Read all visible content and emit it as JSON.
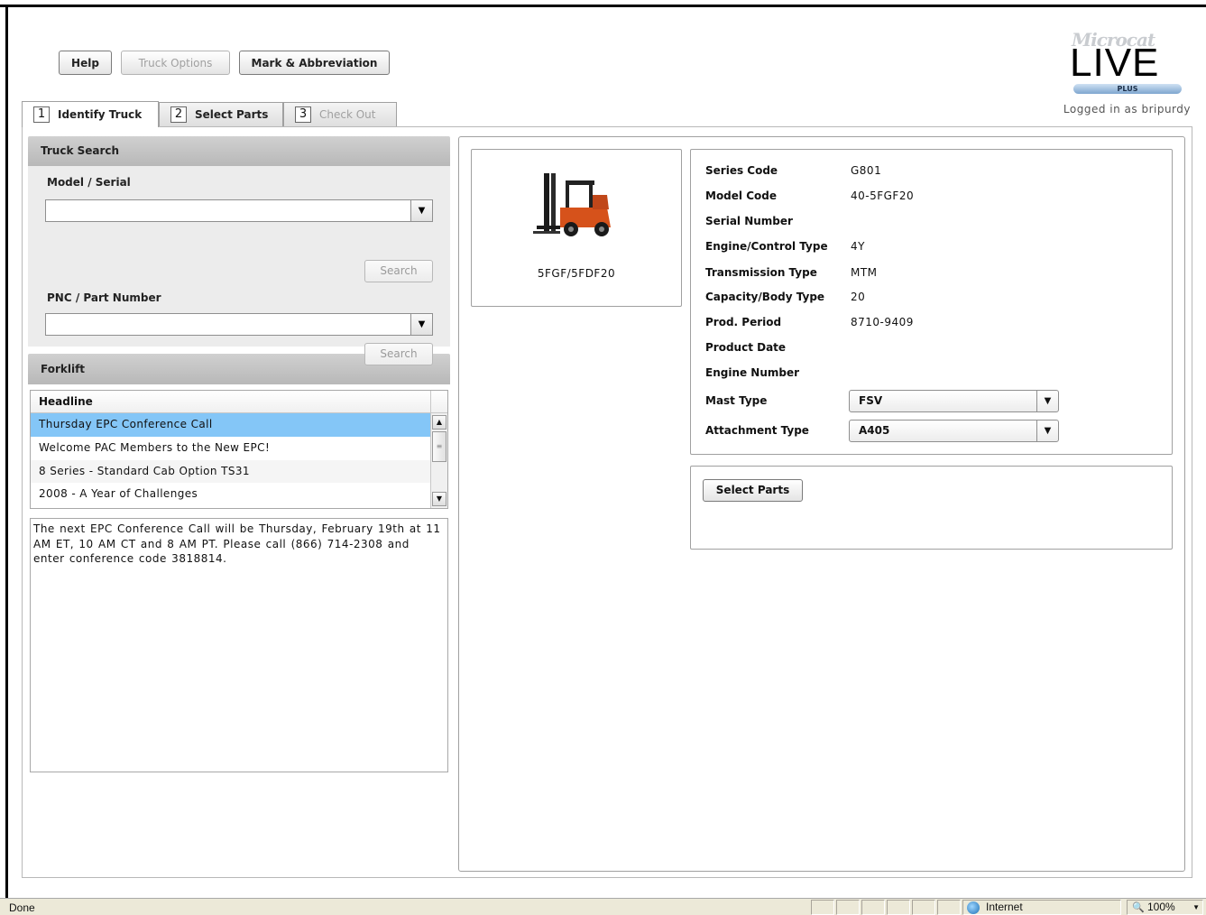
{
  "toolbar": {
    "help_label": "Help",
    "truck_options_label": "Truck Options",
    "mark_abbrev_label": "Mark & Abbreviation"
  },
  "logo": {
    "micro": "Microcat",
    "live": "LIVE",
    "plus": "PLUS"
  },
  "user": {
    "logged_in_text": "Logged in as bripurdy"
  },
  "tabs": [
    {
      "num": "1",
      "label": "Identify Truck",
      "state": "active"
    },
    {
      "num": "2",
      "label": "Select Parts",
      "state": "enabled"
    },
    {
      "num": "3",
      "label": "Check Out",
      "state": "disabled"
    }
  ],
  "truck_search": {
    "title": "Truck Search",
    "model_serial_label": "Model / Serial",
    "model_serial_value": "",
    "search1_label": "Search",
    "pnc_label": "PNC / Part Number",
    "pnc_value": "",
    "search2_label": "Search"
  },
  "forklift": {
    "title": "Forklift",
    "column_header": "Headline",
    "items": [
      "Thursday EPC Conference Call",
      "Welcome PAC Members to the New EPC!",
      "8 Series - Standard Cab Option TS31",
      "2008 - A Year of Challenges"
    ],
    "selected_index": 0,
    "detail_text": "The next EPC Conference Call will be Thursday, February 19th at 11 AM ET, 10 AM CT and 8 AM PT.  Please call (866) 714-2308 and enter conference code 3818814."
  },
  "truck": {
    "image_caption": "5FGF/5FDF20",
    "fields": [
      {
        "label": "Series Code",
        "value": "G801"
      },
      {
        "label": "Model Code",
        "value": "40-5FGF20"
      },
      {
        "label": "Serial Number",
        "value": ""
      },
      {
        "label": "Engine/Control Type",
        "value": "4Y"
      },
      {
        "label": "Transmission Type",
        "value": "MTM"
      },
      {
        "label": "Capacity/Body Type",
        "value": "20"
      },
      {
        "label": "Prod. Period",
        "value": "8710-9409"
      },
      {
        "label": "Product Date",
        "value": ""
      },
      {
        "label": "Engine Number",
        "value": ""
      }
    ],
    "mast_type_label": "Mast Type",
    "mast_type_value": "FSV",
    "attachment_type_label": "Attachment Type",
    "attachment_type_value": "A405",
    "select_parts_label": "Select Parts"
  },
  "statusbar": {
    "status_text": "Done",
    "zone": "Internet",
    "zoom": "100%"
  },
  "colors": {
    "selected_row": "#84c6f7",
    "section_header": "#c4c4c4"
  }
}
